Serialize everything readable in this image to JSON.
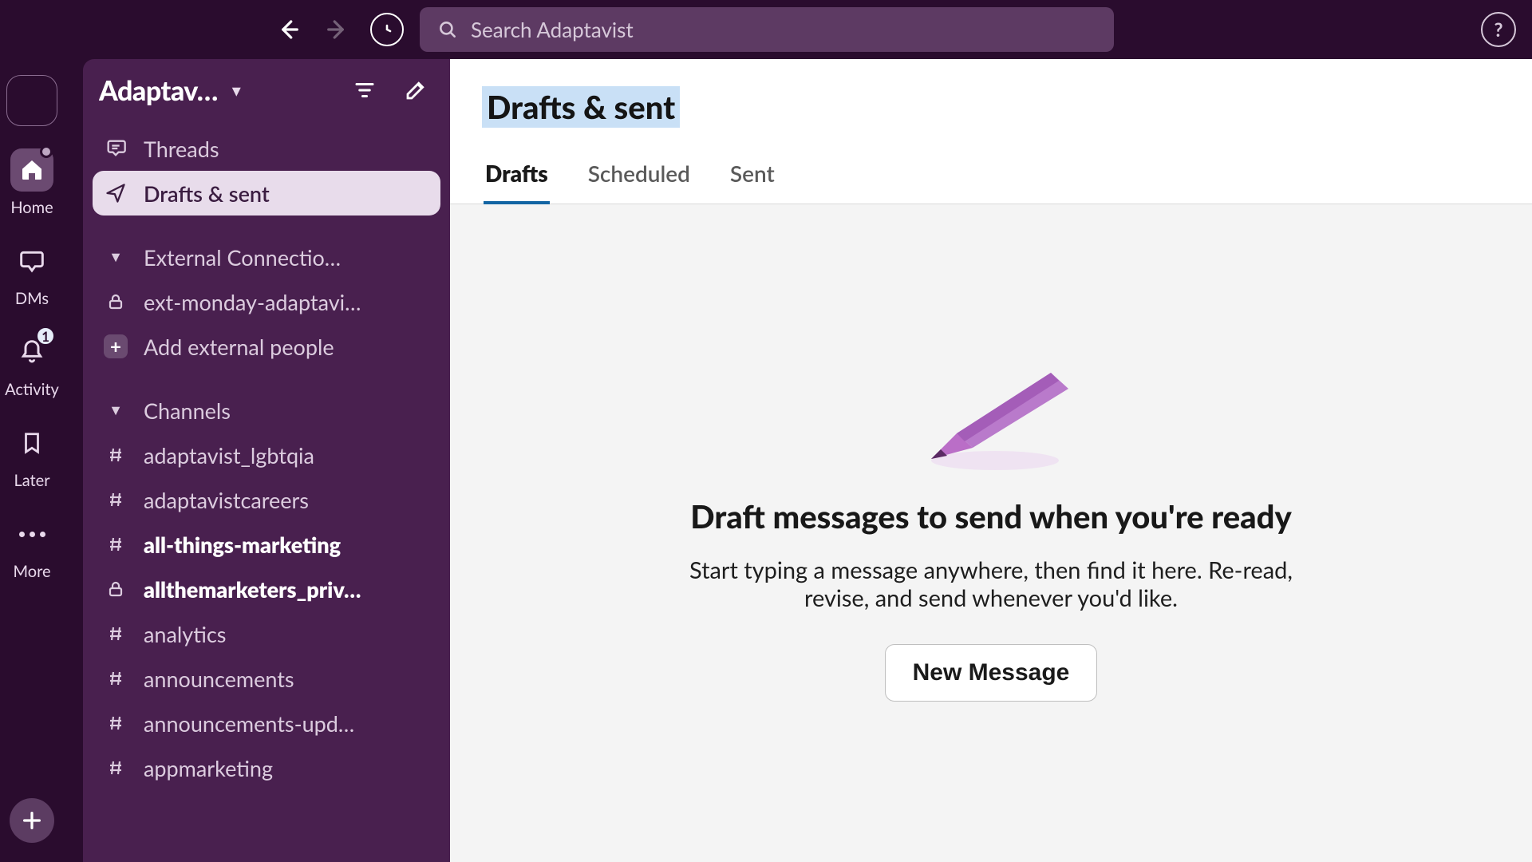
{
  "search": {
    "placeholder": "Search Adaptavist"
  },
  "rail": {
    "home": {
      "label": "Home"
    },
    "dms": {
      "label": "DMs"
    },
    "activity": {
      "label": "Activity",
      "badge": "1"
    },
    "later": {
      "label": "Later"
    },
    "more": {
      "label": "More"
    }
  },
  "workspace": {
    "name": "Adaptav…"
  },
  "sidebar": {
    "threads_label": "Threads",
    "drafts_label": "Drafts & sent",
    "ext_section": "External Connectio…",
    "ext_channel": "ext-monday-adaptavi…",
    "add_external": "Add external people",
    "channels_label": "Channels",
    "channels": [
      {
        "name": "adaptavist_lgbtqia",
        "bold": false,
        "locked": false
      },
      {
        "name": "adaptavistcareers",
        "bold": false,
        "locked": false
      },
      {
        "name": "all-things-marketing",
        "bold": true,
        "locked": false
      },
      {
        "name": "allthemarketers_priv…",
        "bold": true,
        "locked": true
      },
      {
        "name": "analytics",
        "bold": false,
        "locked": false
      },
      {
        "name": "announcements",
        "bold": false,
        "locked": false
      },
      {
        "name": "announcements-upd…",
        "bold": false,
        "locked": false
      },
      {
        "name": "appmarketing",
        "bold": false,
        "locked": false
      }
    ]
  },
  "main": {
    "title": "Drafts & sent",
    "tabs": {
      "drafts": "Drafts",
      "scheduled": "Scheduled",
      "sent": "Sent"
    },
    "empty": {
      "title": "Draft messages to send when you're ready",
      "sub": "Start typing a message anywhere, then find it here. Re-read, revise, and send whenever you'd like.",
      "cta": "New Message"
    }
  }
}
